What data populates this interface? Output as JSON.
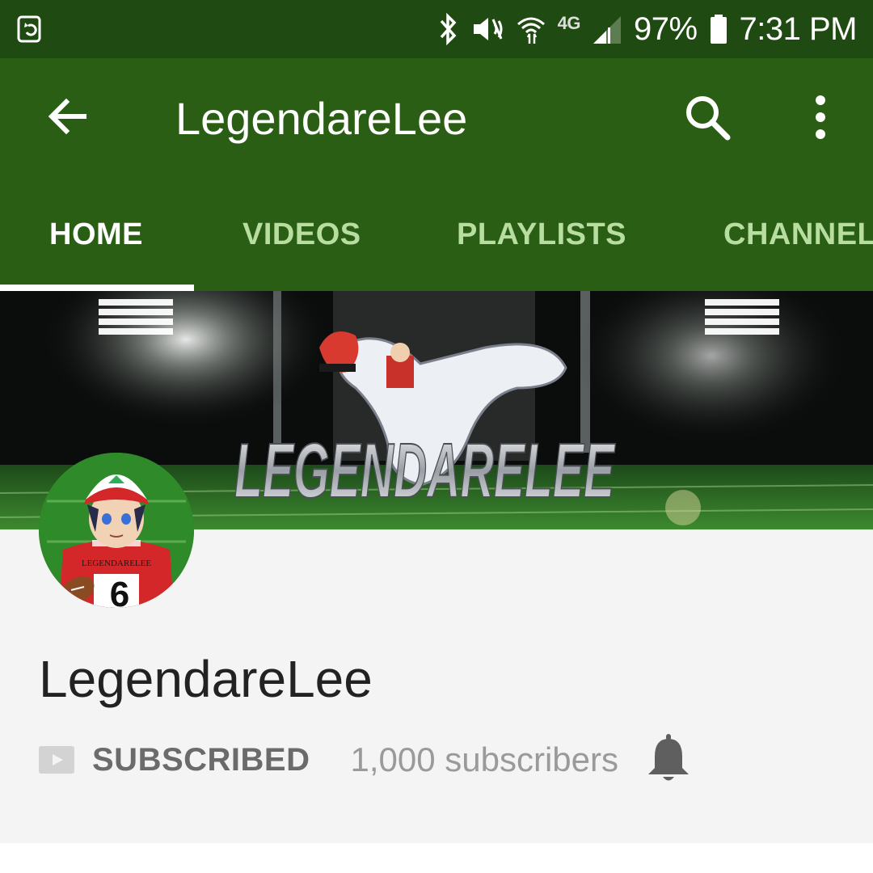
{
  "status_bar": {
    "battery": "97%",
    "time": "7:31 PM",
    "network": "4G",
    "icons": [
      "screen-rotate-icon",
      "bluetooth-icon",
      "mute-vibrate-icon",
      "wifi-icon",
      "signal-icon",
      "battery-icon"
    ]
  },
  "app_bar": {
    "title": "LegendareLee",
    "back_icon": "back-arrow-icon",
    "search_icon": "search-icon",
    "more_icon": "more-vert-icon",
    "background_color": "#2a5e14",
    "status_color": "#1f4a12"
  },
  "tabs": [
    {
      "label": "HOME",
      "active": true
    },
    {
      "label": "VIDEOS",
      "active": false
    },
    {
      "label": "PLAYLISTS",
      "active": false
    },
    {
      "label": "CHANNEL",
      "active": false
    }
  ],
  "banner": {
    "logo_text": "LEGENDARELEE"
  },
  "channel": {
    "name": "LegendareLee",
    "subscribe_status": "SUBSCRIBED",
    "subscribers": "1,000 subscribers",
    "avatar_jersey_text": "LEGENDARELEE",
    "avatar_jersey_number": "6",
    "icons": [
      "youtube-play-icon",
      "notification-bell-icon"
    ]
  }
}
